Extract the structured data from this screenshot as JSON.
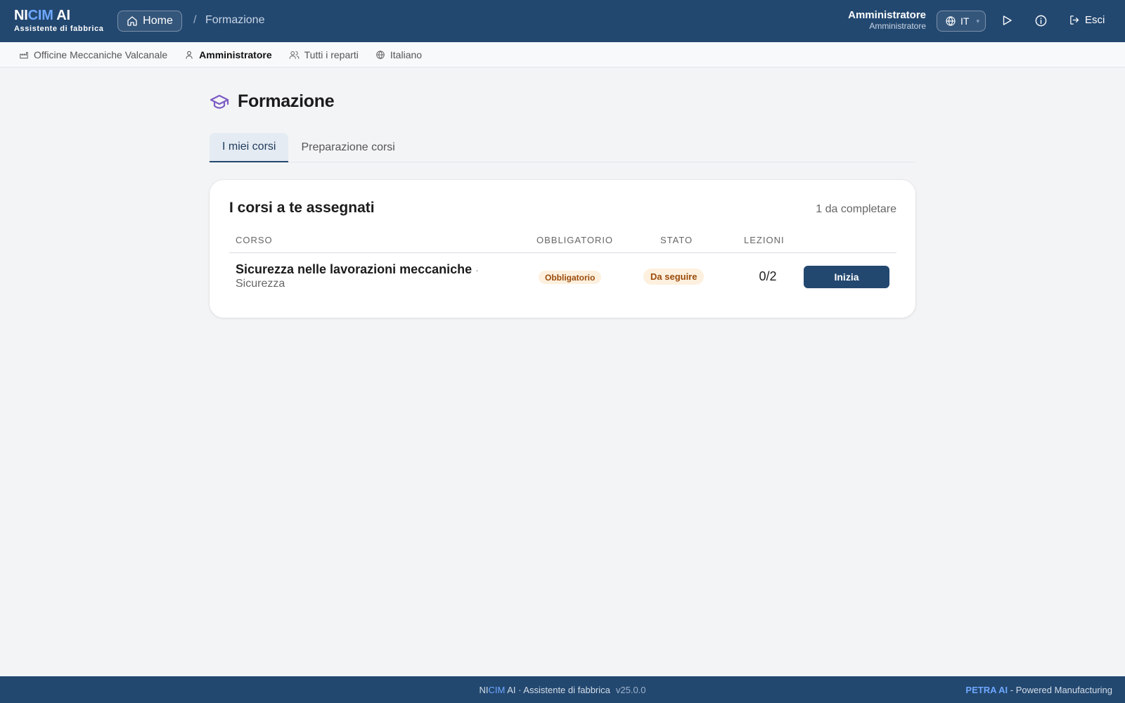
{
  "header": {
    "brand_prefix": "NI",
    "brand_highlight": "CIM",
    "brand_suffix": " AI",
    "brand_subtitle": "Assistente di fabbrica",
    "home_label": "Home",
    "breadcrumb_separator": "/",
    "breadcrumb_current": "Formazione",
    "user_name": "Amministratore",
    "user_role": "Amministratore",
    "language_code": "IT",
    "logout_label": "Esci"
  },
  "subbar": {
    "company": "Officine Meccaniche Valcanale",
    "role": "Amministratore",
    "department": "Tutti i reparti",
    "language": "Italiano"
  },
  "page": {
    "title": "Formazione",
    "tabs": [
      {
        "label": "I miei corsi",
        "active": true
      },
      {
        "label": "Preparazione corsi",
        "active": false
      }
    ]
  },
  "courses_card": {
    "title": "I corsi a te assegnati",
    "pending_count": "1 da completare",
    "columns": [
      "CORSO",
      "OBBLIGATORIO",
      "STATO",
      "LEZIONI"
    ],
    "rows": [
      {
        "name": "Sicurezza nelle lavorazioni meccaniche",
        "separator": "·",
        "category": "Sicurezza",
        "mandatory": "Obbligatorio",
        "status": "Da seguire",
        "lessons": "0/2",
        "action": "Inizia"
      }
    ]
  },
  "footer": {
    "brand_prefix": "NI",
    "brand_highlight": "CIM",
    "brand_rest": " AI · Assistente di fabbrica",
    "version": "v25.0.0",
    "right_brand": "PETRA AI",
    "right_text": " - Powered Manufacturing"
  },
  "colors": {
    "primary": "#234870",
    "accent": "#6ea8ff",
    "badge_bg": "#fdf0de",
    "badge_text": "#9a4b0b",
    "page_icon": "#7c5cc4"
  },
  "icons": [
    "home-icon",
    "globe-icon",
    "play-icon",
    "info-icon",
    "logout-icon",
    "factory-icon",
    "user-icon",
    "users-icon",
    "graduation-cap-icon"
  ]
}
